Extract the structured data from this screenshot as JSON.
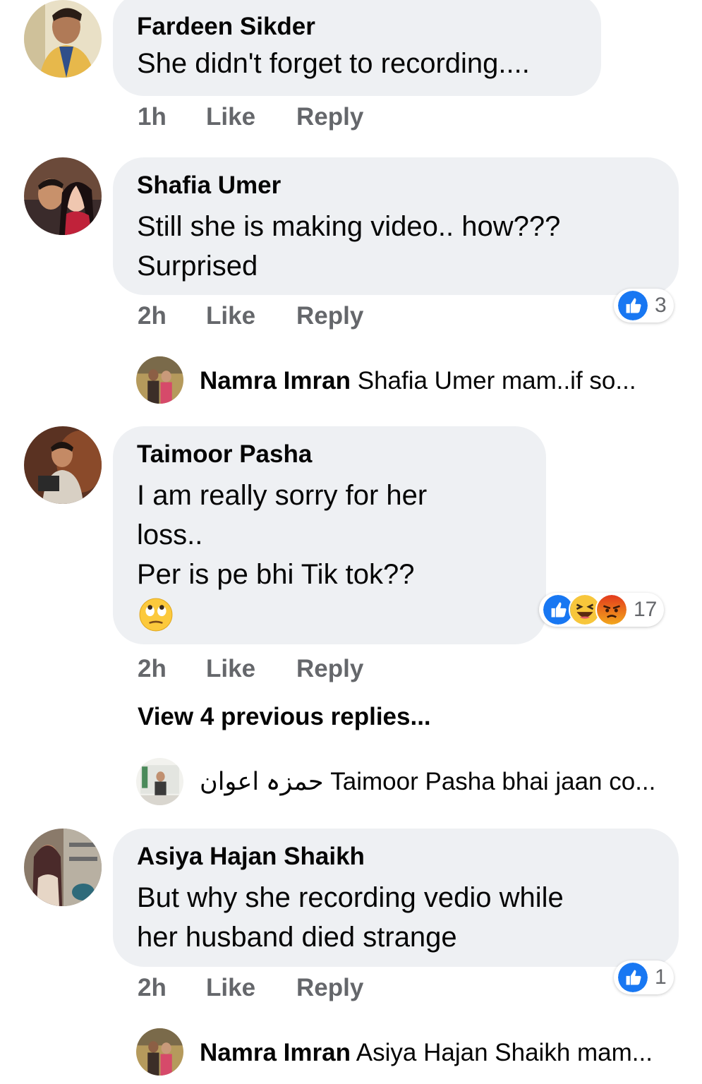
{
  "comments": [
    {
      "author": "Fardeen Sikder",
      "text": "She didn't forget to recording....",
      "time": "1h",
      "like_label": "Like",
      "reply_label": "Reply"
    },
    {
      "author": "Shafia Umer",
      "text": "Still she is making video.. how???\nSurprised",
      "time": "2h",
      "like_label": "Like",
      "reply_label": "Reply",
      "reactions": {
        "icons": [
          "like"
        ],
        "count": "3"
      }
    },
    {
      "author": "Taimoor Pasha",
      "text": "I am really sorry for her\nloss..\nPer is pe bhi Tik tok??",
      "emoji": "face-with-rolling-eyes",
      "time": "2h",
      "like_label": "Like",
      "reply_label": "Reply",
      "reactions": {
        "icons": [
          "like",
          "haha",
          "angry"
        ],
        "count": "17"
      }
    },
    {
      "author": "Asiya Hajan Shaikh",
      "text": "But why she recording vedio while\nher husband died strange",
      "time": "2h",
      "like_label": "Like",
      "reply_label": "Reply",
      "reactions": {
        "icons": [
          "like"
        ],
        "count": "1"
      }
    }
  ],
  "replies": [
    {
      "author": "Namra Imran",
      "preview": "Shafia Umer  mam..if so..."
    },
    {
      "author": "حمزہ اعوان",
      "preview": "Taimoor Pasha bhai jaan co..."
    },
    {
      "author": "Namra Imran",
      "preview": "Asiya Hajan Shaikh  mam..."
    }
  ],
  "view_previous_replies": "View 4 previous replies...",
  "colors": {
    "bubble": "#eef0f3",
    "meta_text": "#65676b",
    "like_blue": "#1877f2",
    "haha_yellow": "#f7c63b",
    "angry_orange": "#e9710f"
  }
}
